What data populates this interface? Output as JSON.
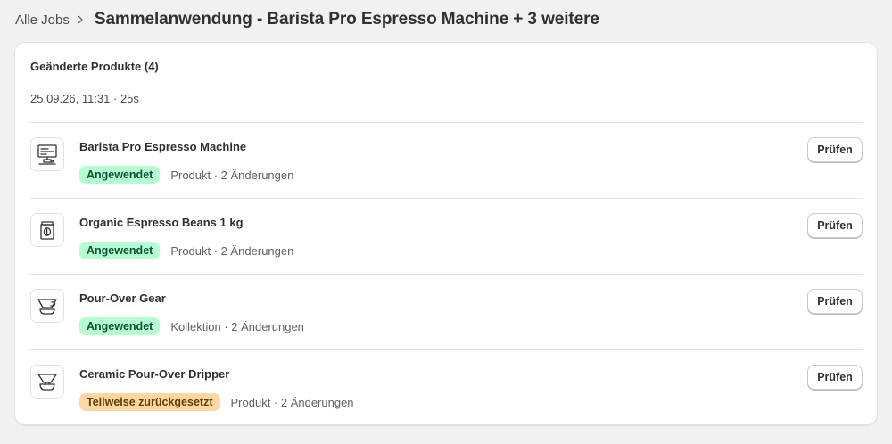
{
  "breadcrumb": {
    "parent": "Alle Jobs",
    "title": "Sammelanwendung - Barista Pro Espresso Machine + 3 weitere"
  },
  "card": {
    "heading": "Geänderte Produkte (4)",
    "meta": "25.09.26, 11:31 · 25s",
    "items": [
      {
        "title": "Barista Pro Espresso Machine",
        "icon": "espresso-machine-icon",
        "badge": "Angewendet",
        "badge_color": "#b4fed2",
        "detail": "Produkt · 2 Änderungen",
        "button": "Prüfen"
      },
      {
        "title": "Organic Espresso Beans 1 kg",
        "icon": "coffee-bag-icon",
        "badge": "Angewendet",
        "badge_color": "#b4fed2",
        "detail": "Produkt · 2 Änderungen",
        "button": "Prüfen"
      },
      {
        "title": "Pour-Over Gear",
        "icon": "pour-over-icon",
        "badge": "Angewendet",
        "badge_color": "#b4fed2",
        "detail": "Kollektion · 2 Änderungen",
        "button": "Prüfen"
      },
      {
        "title": "Ceramic Pour-Over Dripper",
        "icon": "dripper-icon",
        "badge": "Teilweise zurückgesetzt",
        "badge_color": "#ffd6a4",
        "detail": "Produkt · 2 Änderungen",
        "button": "Prüfen"
      }
    ]
  }
}
